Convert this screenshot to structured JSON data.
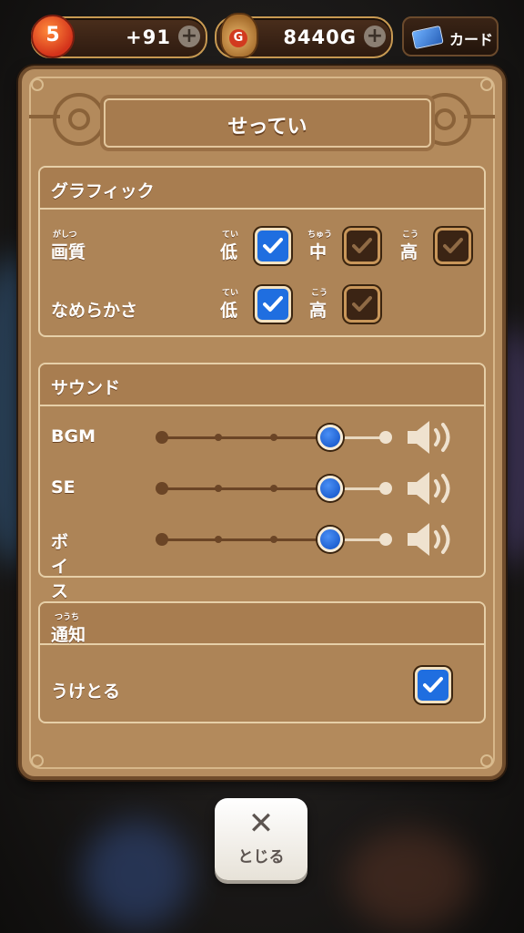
{
  "status_bar": {
    "stamina": {
      "badge": "5",
      "value": "+91"
    },
    "gold": {
      "badge": "G",
      "value": "8440G"
    },
    "card_label": "カード",
    "plus_symbol": "+"
  },
  "dialog": {
    "title": "せってい",
    "graphics": {
      "title": "グラフィック",
      "quality": {
        "label": "画質",
        "label_ruby": "がしつ",
        "options": [
          {
            "char": "低",
            "ruby": "てい",
            "checked": true
          },
          {
            "char": "中",
            "ruby": "ちゅう",
            "checked": false
          },
          {
            "char": "高",
            "ruby": "こう",
            "checked": false
          }
        ]
      },
      "smoothness": {
        "label": "なめらかさ",
        "options": [
          {
            "char": "低",
            "ruby": "てい",
            "checked": true
          },
          {
            "char": "高",
            "ruby": "こう",
            "checked": false
          }
        ]
      }
    },
    "sound": {
      "title": "サウンド",
      "sliders": [
        {
          "label": "BGM",
          "level": 0.75
        },
        {
          "label": "SE",
          "level": 0.75
        },
        {
          "label": "ボイス",
          "level": 0.75
        }
      ]
    },
    "notification": {
      "title": "通知",
      "title_ruby": "つうち",
      "receive": {
        "label": "うけとる",
        "checked": true
      }
    }
  },
  "close_button": {
    "symbol": "✕",
    "label": "とじる"
  },
  "colors": {
    "accent_blue": "#1f6ee0",
    "panel_brown": "#b58d60",
    "frame_brown": "#6f4c2c"
  },
  "icons": [
    "heart-icon",
    "gold-bag-icon",
    "card-icon",
    "plus-icon",
    "checkmark-icon",
    "speaker-icon",
    "close-icon"
  ]
}
